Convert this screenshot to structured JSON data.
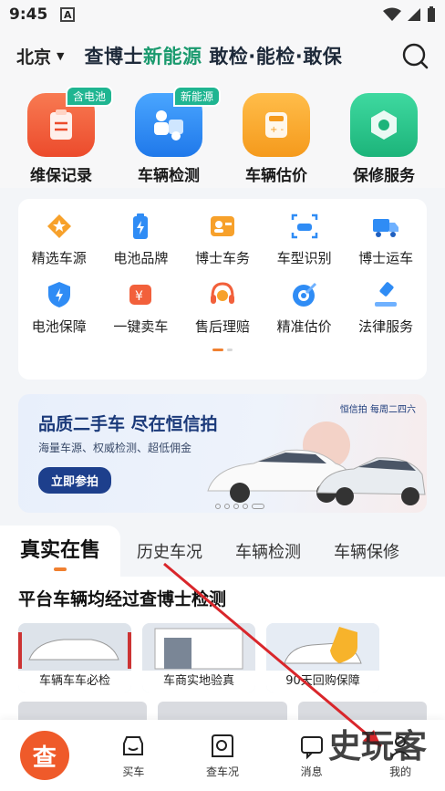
{
  "status": {
    "time": "9:45",
    "notif_icon": "A"
  },
  "header": {
    "city": "北京",
    "slogan_a": "查博士",
    "slogan_b": "新能源",
    "slogan_c": " 敢检·能检·敢保"
  },
  "top_icons": [
    {
      "label": "维保记录",
      "badge": "含电池",
      "color": "#f2603b"
    },
    {
      "label": "车辆检测",
      "badge": "新能源",
      "color": "#2f8cf5"
    },
    {
      "label": "车辆估价",
      "badge": "",
      "color": "#f7a12b"
    },
    {
      "label": "保修服务",
      "badge": "",
      "color": "#26c08a"
    }
  ],
  "grid_row1": [
    {
      "label": "精选车源",
      "icon": "star-diamond-icon"
    },
    {
      "label": "电池品牌",
      "icon": "battery-icon"
    },
    {
      "label": "博士车务",
      "icon": "profile-card-icon"
    },
    {
      "label": "车型识别",
      "icon": "car-scan-icon"
    },
    {
      "label": "博士运车",
      "icon": "truck-icon"
    }
  ],
  "grid_row2": [
    {
      "label": "电池保障",
      "icon": "shield-bolt-icon"
    },
    {
      "label": "一键卖车",
      "icon": "sell-yuan-icon"
    },
    {
      "label": "售后理赔",
      "icon": "headset-icon"
    },
    {
      "label": "精准估价",
      "icon": "target-icon"
    },
    {
      "label": "法律服务",
      "icon": "gavel-icon"
    }
  ],
  "banner": {
    "title": "品质二手车 尽在恒信拍",
    "subtitle": "海量车源、权威检测、超低佣金",
    "button": "立即参拍",
    "tag": "恒信拍 每周二四六"
  },
  "tabs": [
    "真实在售",
    "历史车况",
    "车辆检测",
    "车辆保修"
  ],
  "section": {
    "title": "平台车辆均经过查博士检测",
    "cards": [
      "车辆车车必检",
      "车商实地验真",
      "90天回购保障"
    ]
  },
  "tabbar": [
    {
      "label": "",
      "icon": "home-cha-icon",
      "glyph": "查"
    },
    {
      "label": "买车",
      "icon": "car-front-icon"
    },
    {
      "label": "查车况",
      "icon": "search-car-icon"
    },
    {
      "label": "消息",
      "icon": "message-icon"
    },
    {
      "label": "我的",
      "icon": "user-icon"
    }
  ],
  "watermark": "史玩客"
}
